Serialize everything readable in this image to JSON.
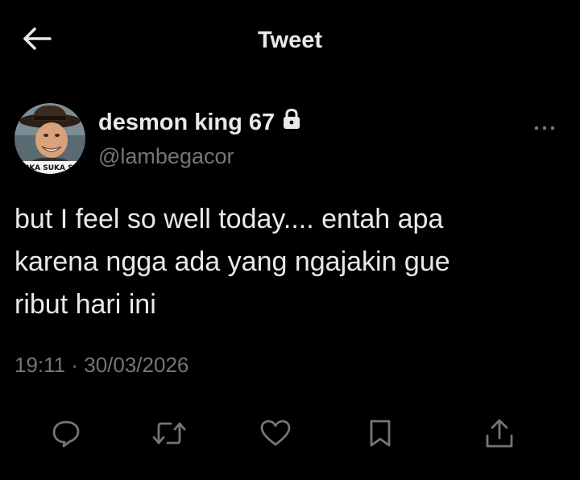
{
  "header": {
    "title": "Tweet",
    "back_icon": "arrow-left-icon"
  },
  "tweet": {
    "author": {
      "display_name": "desmon king 67",
      "handle": "@lambegacor",
      "protected_icon": "lock-icon",
      "avatar_caption": "SUKA SUKA SA"
    },
    "text": "but I feel so well today.... entah apa\nkarena ngga ada yang ngajakin gue\nribut hari ini",
    "timestamp": "19:11 · 30/03/2026",
    "more_icon": "ellipsis-icon"
  },
  "actions": [
    {
      "name": "reply",
      "icon": "reply-icon"
    },
    {
      "name": "retweet",
      "icon": "retweet-icon"
    },
    {
      "name": "like",
      "icon": "heart-icon"
    },
    {
      "name": "bookmark",
      "icon": "bookmark-icon"
    },
    {
      "name": "share",
      "icon": "share-icon"
    }
  ],
  "colors": {
    "background": "#000000",
    "text_primary": "#e7e9ea",
    "text_secondary": "#71767b",
    "icon": "#71767b"
  }
}
